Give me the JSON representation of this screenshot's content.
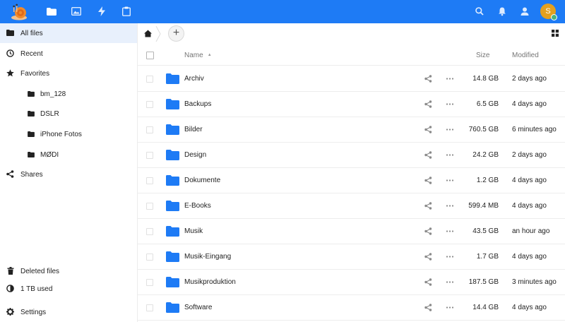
{
  "header": {
    "apps": [
      {
        "name": "files",
        "icon": "folder-icon"
      },
      {
        "name": "photos",
        "icon": "image-icon"
      },
      {
        "name": "activity",
        "icon": "lightning-icon"
      },
      {
        "name": "deck",
        "icon": "clipboard-icon"
      }
    ],
    "avatar_initial": "S",
    "colors": {
      "brand": "#1e7bf5",
      "avatar": "#e3a020",
      "status_online": "#49b382"
    }
  },
  "sidebar": {
    "items": [
      {
        "label": "All files",
        "icon": "folder-icon"
      },
      {
        "label": "Recent",
        "icon": "clock-icon"
      },
      {
        "label": "Favorites",
        "icon": "star-icon"
      },
      {
        "label": "bm_128",
        "icon": "folder-icon"
      },
      {
        "label": "DSLR",
        "icon": "folder-icon"
      },
      {
        "label": "iPhone Fotos",
        "icon": "folder-icon"
      },
      {
        "label": "MØDI",
        "icon": "folder-icon"
      },
      {
        "label": "Shares",
        "icon": "share-icon"
      }
    ],
    "footer": {
      "deleted": "Deleted files",
      "quota": "1 TB used",
      "settings": "Settings"
    }
  },
  "table": {
    "columns": {
      "name": "Name",
      "size": "Size",
      "modified": "Modified"
    },
    "rows": [
      {
        "name": "Archiv",
        "size": "14.8 GB",
        "modified": "2 days ago"
      },
      {
        "name": "Backups",
        "size": "6.5 GB",
        "modified": "4 days ago"
      },
      {
        "name": "Bilder",
        "size": "760.5 GB",
        "modified": "6 minutes ago"
      },
      {
        "name": "Design",
        "size": "24.2 GB",
        "modified": "2 days ago"
      },
      {
        "name": "Dokumente",
        "size": "1.2 GB",
        "modified": "4 days ago"
      },
      {
        "name": "E-Books",
        "size": "599.4 MB",
        "modified": "4 days ago"
      },
      {
        "name": "Musik",
        "size": "43.5 GB",
        "modified": "an hour ago"
      },
      {
        "name": "Musik-Eingang",
        "size": "1.7 GB",
        "modified": "4 days ago"
      },
      {
        "name": "Musikproduktion",
        "size": "187.5 GB",
        "modified": "3 minutes ago"
      },
      {
        "name": "Software",
        "size": "14.4 GB",
        "modified": "4 days ago"
      }
    ]
  },
  "colors": {
    "folder": "#1e7bf5",
    "active_nav_bg": "#e8f0fc"
  }
}
